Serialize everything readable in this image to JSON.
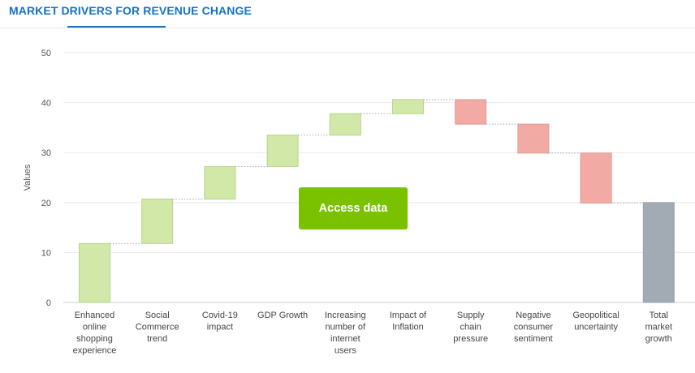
{
  "header": {
    "title": "MARKET DRIVERS FOR REVENUE CHANGE"
  },
  "access_button": {
    "label": "Access data"
  },
  "colors": {
    "increase": "#d1e8a9",
    "decrease": "#f2aba4",
    "total": "#a2aab3",
    "accent": "#1572c6",
    "button": "#7ac200"
  },
  "chart_data": {
    "type": "bar",
    "subtype": "waterfall",
    "title": "",
    "xlabel": "",
    "ylabel": "Values",
    "ylim": [
      0,
      50
    ],
    "yticks": [
      0,
      10,
      20,
      30,
      40,
      50
    ],
    "grid": true,
    "categories": [
      [
        "Enhanced",
        "online",
        "shopping",
        "experience"
      ],
      [
        "Social",
        "Commerce",
        "trend"
      ],
      [
        "Covid-19",
        "impact"
      ],
      [
        "GDP Growth"
      ],
      [
        "Increasing",
        "number of",
        "internet",
        "users"
      ],
      [
        "Impact of",
        "Inflation"
      ],
      [
        "Supply",
        "chain",
        "pressure"
      ],
      [
        "Negative",
        "consumer",
        "sentiment"
      ],
      [
        "Geopolitical",
        "uncertainty"
      ],
      [
        "Total",
        "market",
        "growth"
      ]
    ],
    "values": [
      11.8,
      8.9,
      6.5,
      6.3,
      4.3,
      2.8,
      -4.9,
      -5.8,
      -10.0,
      20.0
    ],
    "kinds": [
      "increase",
      "increase",
      "increase",
      "increase",
      "increase",
      "increase",
      "decrease",
      "decrease",
      "decrease",
      "total"
    ]
  }
}
